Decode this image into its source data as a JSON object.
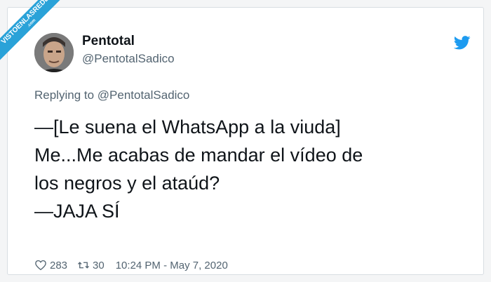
{
  "watermark": {
    "text": "VISTOENLASREDES",
    "sub": ".com"
  },
  "tweet": {
    "author_name": "Pentotal",
    "author_handle": "@PentotalSadico",
    "reply_text": "Replying to @PentotalSadico",
    "lines": [
      "—[Le suena el WhatsApp a la viuda]",
      "Me...Me acabas de mandar el vídeo de",
      "los negros y el ataúd?",
      "—JAJA SÍ"
    ],
    "likes": "283",
    "retweets": "30",
    "timestamp": "10:24 PM - May 7, 2020"
  },
  "icons": {
    "brand": "twitter-bird-icon",
    "like": "heart-icon",
    "retweet": "retweet-icon"
  },
  "colors": {
    "brand": "#1d9bf0",
    "ribbon": "#2aa2d8",
    "text": "#0f1419",
    "secondary": "#536471"
  }
}
